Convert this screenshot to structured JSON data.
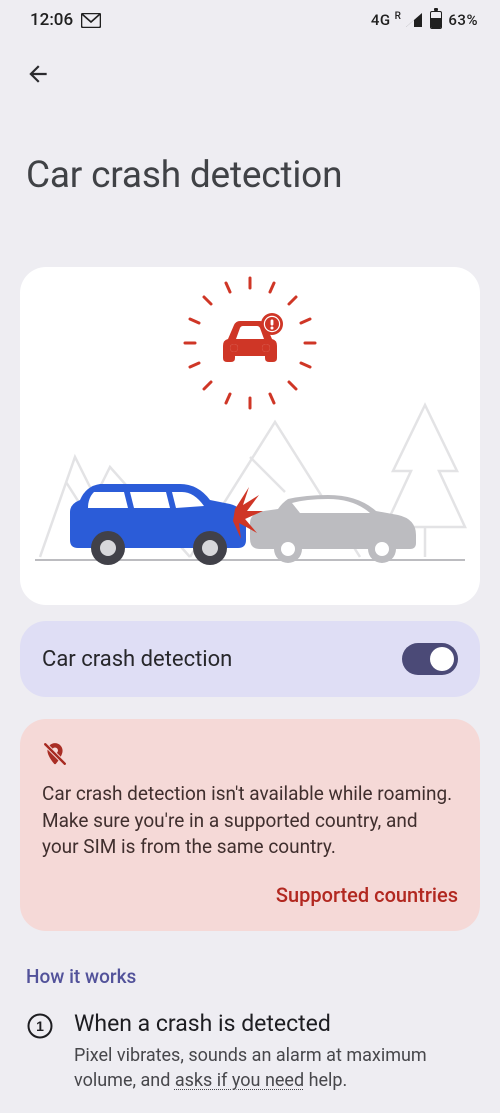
{
  "status": {
    "time": "12:06",
    "net": "4G",
    "roam_glyph": "R",
    "battery_pct": "63%"
  },
  "page": {
    "title": "Car crash detection"
  },
  "toggle": {
    "label": "Car crash detection",
    "on": true
  },
  "warning": {
    "text": "Car crash detection isn't available while roaming. Make sure you're in a supported country, and your SIM is from the same country.",
    "link": "Supported countries"
  },
  "how": {
    "heading": "How it works",
    "steps": [
      {
        "num": "1",
        "title": "When a crash is detected",
        "body_pre": "Pixel vibrates, sounds an alarm at maximum volume, and ",
        "body_u": "asks if you need",
        "body_post": " help."
      }
    ]
  }
}
